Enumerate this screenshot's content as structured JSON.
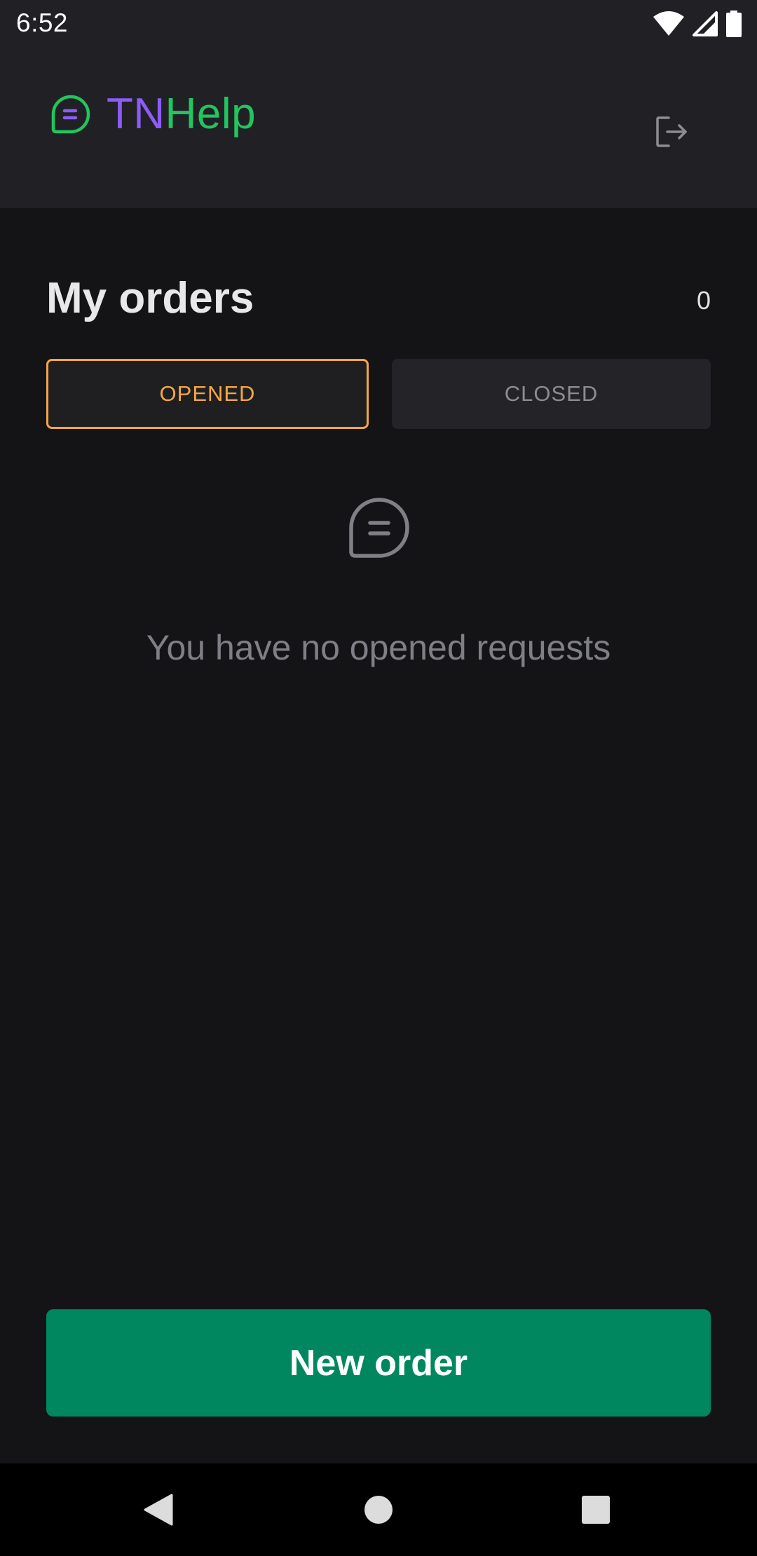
{
  "status_bar": {
    "time": "6:52",
    "icons": [
      "wifi-icon",
      "cellular-signal-icon",
      "battery-icon"
    ]
  },
  "header": {
    "brand_prefix": "TN",
    "brand_suffix": "Help",
    "brand_icon": "chat-bubble-icon",
    "logout_icon": "logout-icon"
  },
  "orders": {
    "title": "My orders",
    "count": "0",
    "tabs": [
      {
        "label": "OPENED",
        "active": true
      },
      {
        "label": "CLOSED",
        "active": false
      }
    ],
    "empty_state": {
      "icon": "chat-bubble-icon",
      "message": "You have no opened requests"
    }
  },
  "actions": {
    "new_order_label": "New order"
  },
  "navigation": {
    "buttons": [
      "back-icon",
      "home-icon",
      "recents-icon"
    ]
  },
  "colors": {
    "brand_purple": "#8b5cf6",
    "brand_green": "#22c55e",
    "active_tab_accent": "#f5a742",
    "primary_button": "#00875f",
    "background": "#141416",
    "header_surface": "#212125"
  }
}
